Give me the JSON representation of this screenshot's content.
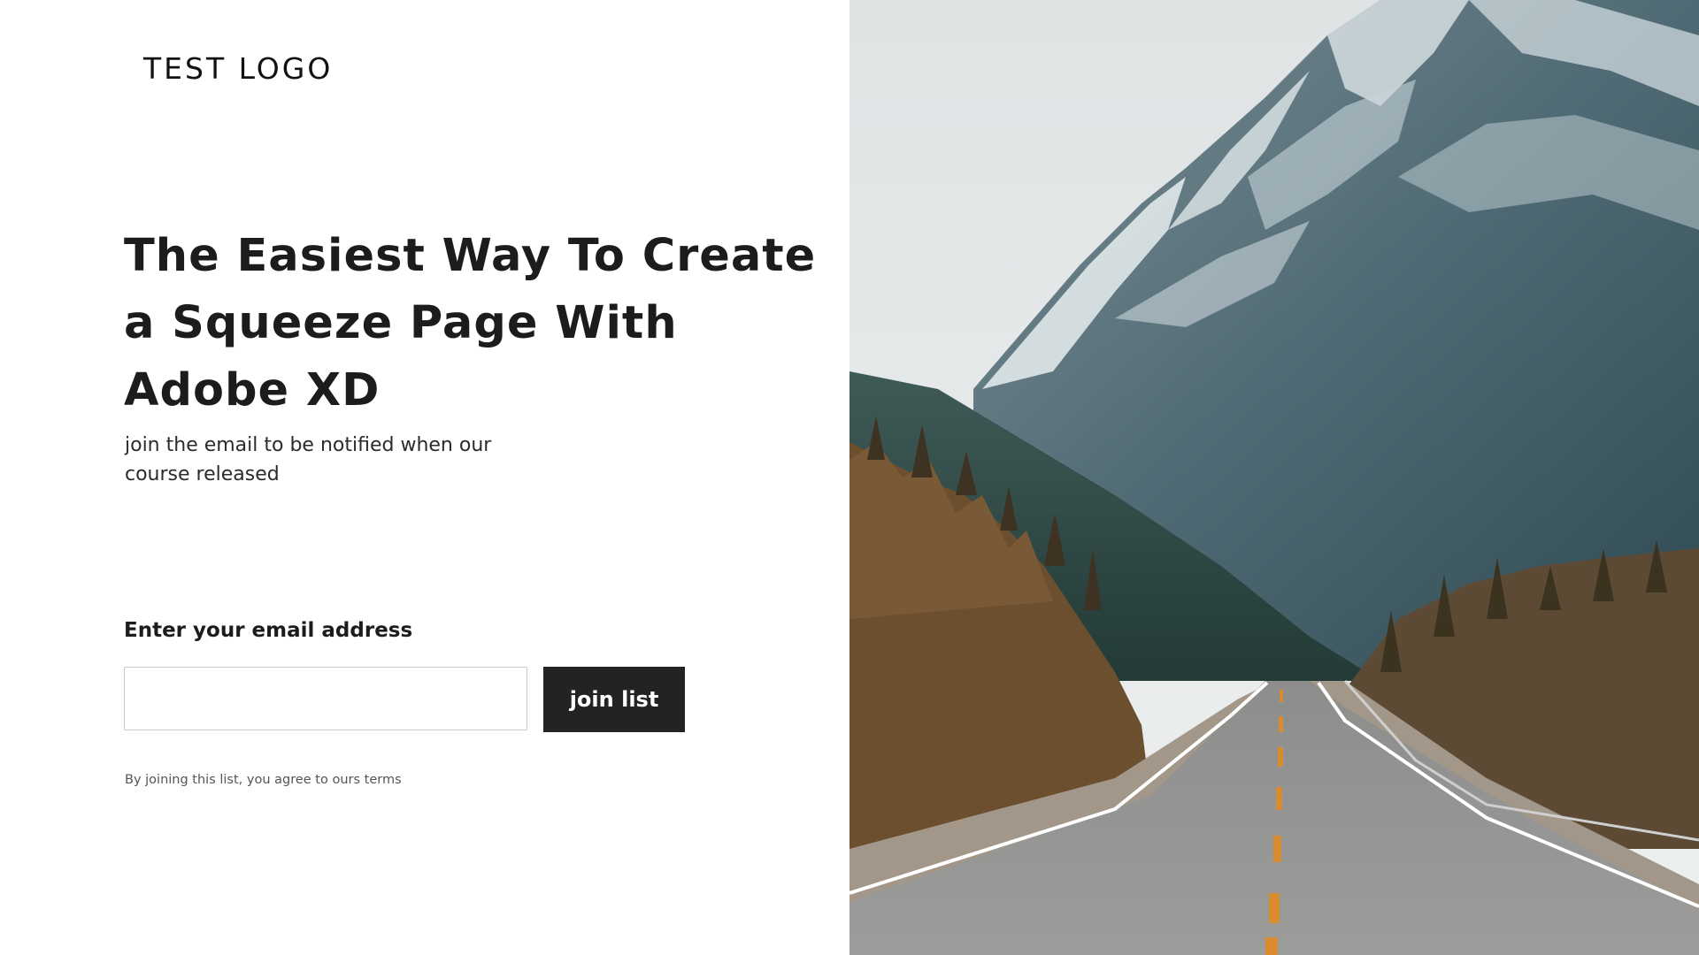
{
  "brand": {
    "logo_text": "TEST LOGO"
  },
  "hero": {
    "headline": "The Easiest Way To Create a Squeeze Page With Adobe XD",
    "subtitle": "join the email to be notified when our course released"
  },
  "form": {
    "email_label": "Enter your email address",
    "email_value": "",
    "email_placeholder": "",
    "submit_label": "join list",
    "terms_text": "By joining this list, you agree to ours terms"
  },
  "image": {
    "subject": "mountain-road-photo"
  },
  "colors": {
    "button_bg": "#232323",
    "button_text": "#ffffff",
    "text_primary": "#1c1c1c",
    "page_bg": "#ffffff"
  }
}
